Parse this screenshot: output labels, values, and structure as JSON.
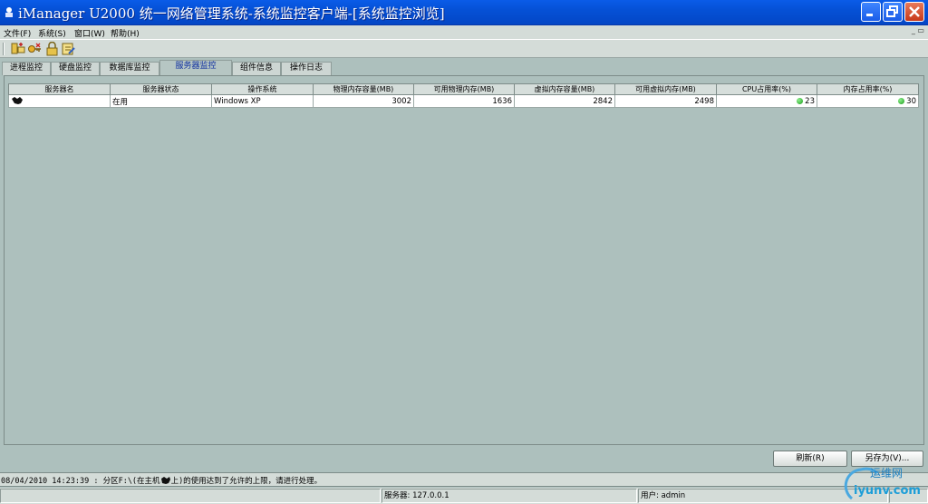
{
  "window": {
    "title": "iManager U2000 统一网络管理系统-系统监控客户端-[系统监控浏览]",
    "controls": [
      "minimize",
      "maximize",
      "close"
    ]
  },
  "menu": {
    "items": [
      "文件(F)",
      "系统(S)",
      "窗口(W)",
      "帮助(H)"
    ],
    "mdi_controls": "_ ▭"
  },
  "toolbar": {
    "icons": [
      "tree-add-icon",
      "key-icon",
      "lock-icon",
      "edit-icon"
    ]
  },
  "tabs": [
    {
      "label": "进程监控",
      "active": false
    },
    {
      "label": "硬盘监控",
      "active": false
    },
    {
      "label": "数据库监控",
      "active": false
    },
    {
      "label": "服务器监控",
      "active": true
    },
    {
      "label": "组件信息",
      "active": false
    },
    {
      "label": "操作日志",
      "active": false
    }
  ],
  "table": {
    "headers": [
      "服务器名",
      "服务器状态",
      "操作系统",
      "物理内存容量(MB)",
      "可用物理内存(MB)",
      "虚拟内存容量(MB)",
      "可用虚拟内存(MB)",
      "CPU占用率(%)",
      "内存占用率(%)"
    ],
    "rows": [
      {
        "name": "",
        "status": "在用",
        "os": "Windows XP",
        "phys_total": "3002",
        "phys_free": "1636",
        "virt_total": "2842",
        "virt_free": "2498",
        "cpu": "23",
        "mem": "30"
      }
    ]
  },
  "buttons": {
    "refresh": "刷新(R)",
    "save_as": "另存为(V)..."
  },
  "message": "08/04/2010 14:23:39 : 分区F:\\(在主机",
  "message_tail": "上)的使用达到了允许的上限，请进行处理。",
  "status": {
    "server": "服务器: 127.0.0.1",
    "user": "用户: admin"
  },
  "watermark": {
    "top": "运维网",
    "bottom": "iyunv.com"
  },
  "colors": {
    "titlebar": "#0551d6",
    "background": "#adc0bd",
    "status_ok": "#1a9a1a"
  }
}
